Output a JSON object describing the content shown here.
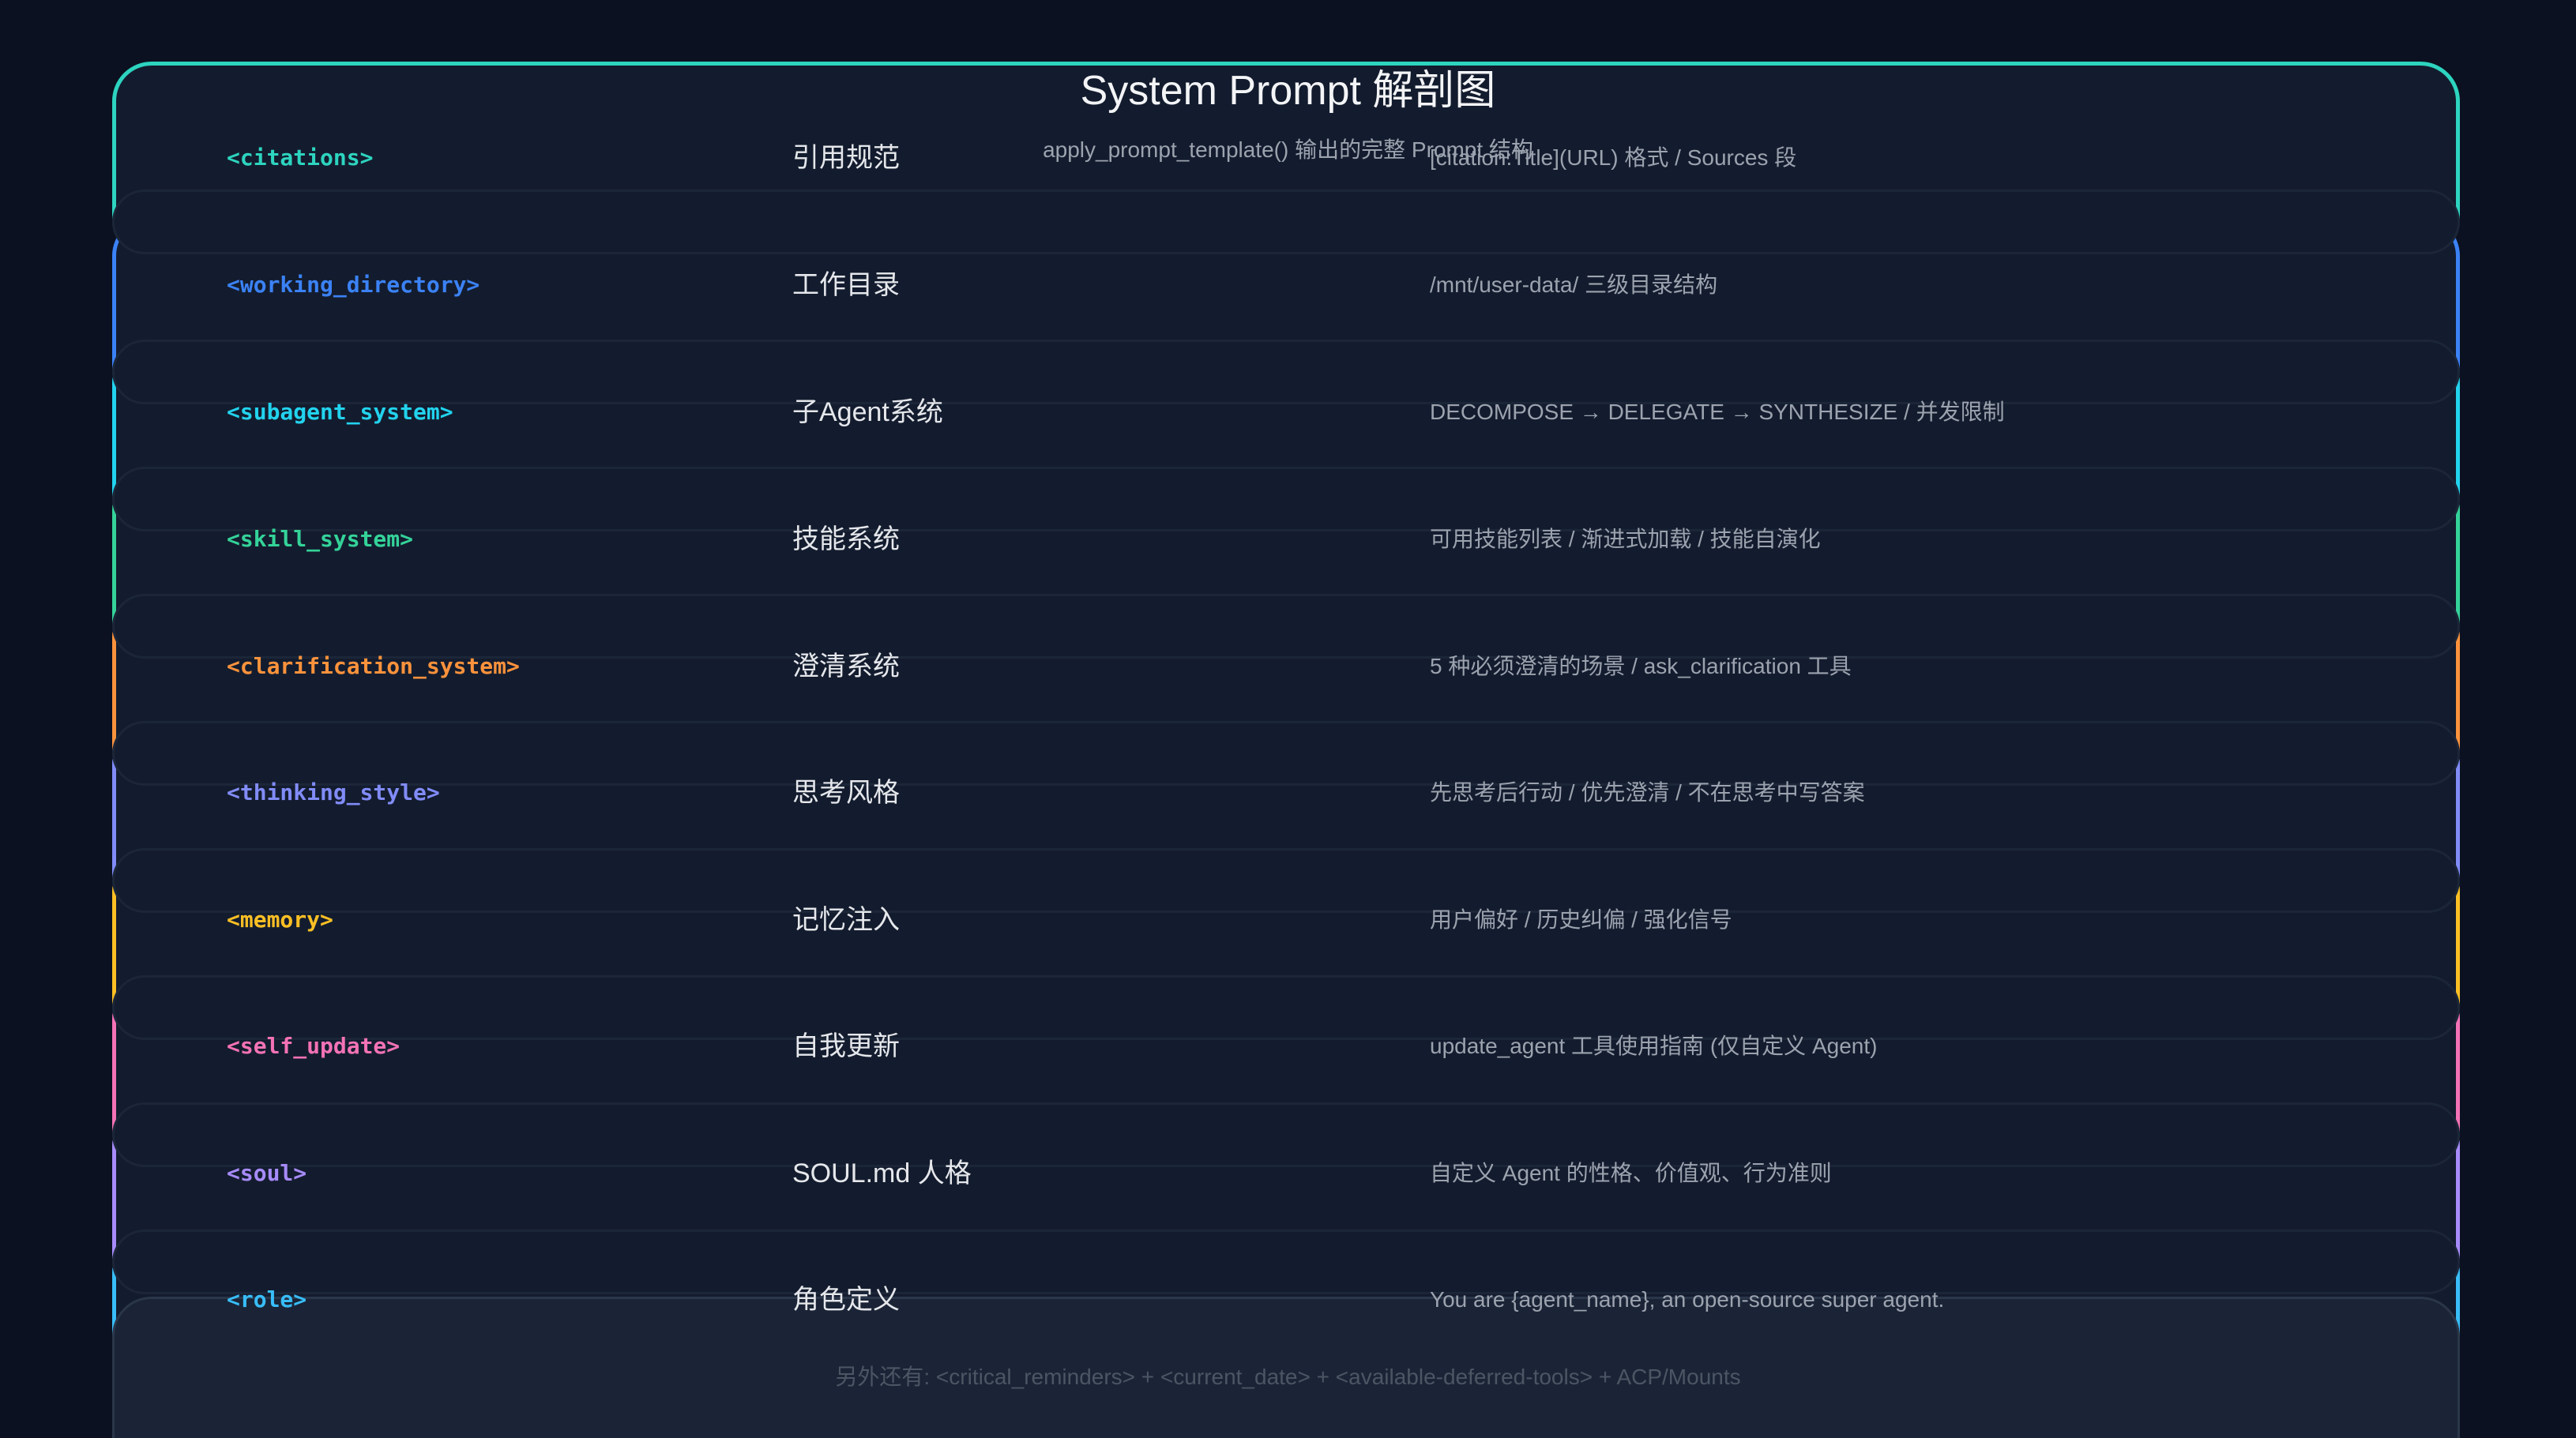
{
  "header": {
    "title": "System Prompt 解剖图",
    "subtitle": "apply_prompt_template() 输出的完整 Prompt 结构"
  },
  "layers": [
    {
      "tag": "<citations>",
      "name": "引用规范",
      "desc": "[citation:Title](URL) 格式 / Sources 段",
      "color": "#2dd4bf"
    },
    {
      "tag": "<working_directory>",
      "name": "工作目录",
      "desc": "/mnt/user-data/ 三级目录结构",
      "color": "#3b82f6"
    },
    {
      "tag": "<subagent_system>",
      "name": "子Agent系统",
      "desc": "DECOMPOSE → DELEGATE → SYNTHESIZE / 并发限制",
      "color": "#22d3ee"
    },
    {
      "tag": "<skill_system>",
      "name": "技能系统",
      "desc": "可用技能列表 / 渐进式加载 / 技能自演化",
      "color": "#34d399"
    },
    {
      "tag": "<clarification_system>",
      "name": "澄清系统",
      "desc": "5 种必须澄清的场景 / ask_clarification 工具",
      "color": "#fb923c"
    },
    {
      "tag": "<thinking_style>",
      "name": "思考风格",
      "desc": "先思考后行动 / 优先澄清 / 不在思考中写答案",
      "color": "#818cf8"
    },
    {
      "tag": "<memory>",
      "name": "记忆注入",
      "desc": "用户偏好 / 历史纠偏 / 强化信号",
      "color": "#fbbf24"
    },
    {
      "tag": "<self_update>",
      "name": "自我更新",
      "desc": "update_agent 工具使用指南 (仅自定义 Agent)",
      "color": "#f472b6"
    },
    {
      "tag": "<soul>",
      "name": "SOUL.md 人格",
      "desc": "自定义 Agent 的性格、价值观、行为准则",
      "color": "#a78bfa"
    },
    {
      "tag": "<role>",
      "name": "角色定义",
      "desc": "You are {agent_name}, an open-source super agent.",
      "color": "#38bdf8"
    }
  ],
  "footer": {
    "note": "另外还有: <critical_reminders> + <current_date> + <available-deferred-tools> + ACP/Mounts"
  }
}
